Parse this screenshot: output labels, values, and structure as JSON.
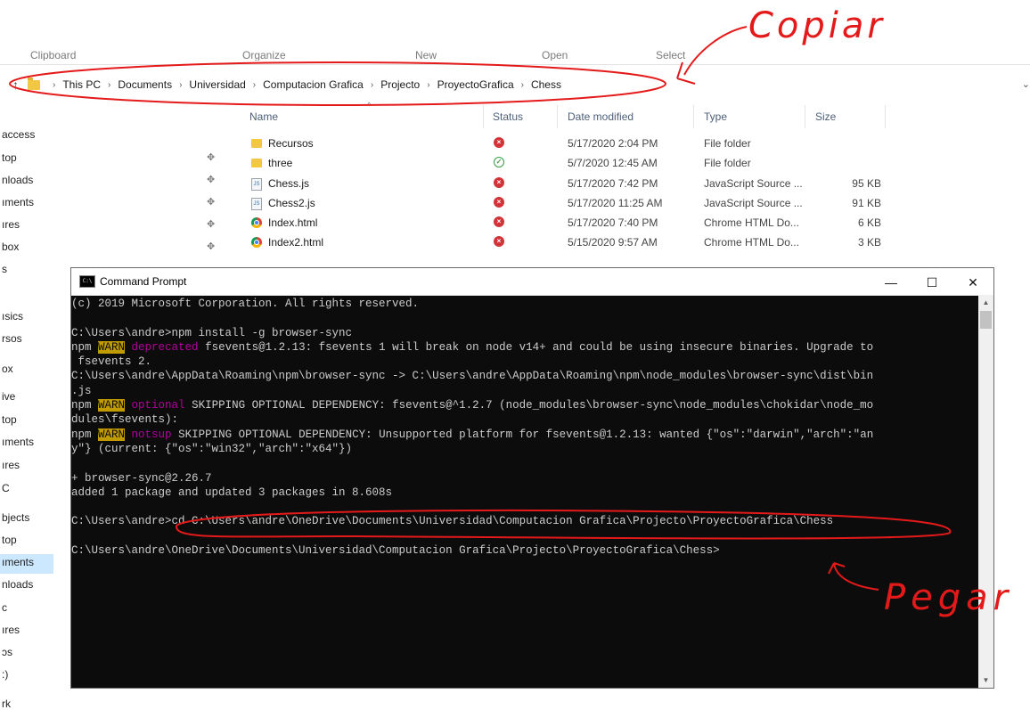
{
  "ribbon": {
    "groups": [
      "Clipboard",
      "Organize",
      "New",
      "Open",
      "Select"
    ]
  },
  "addressbar": {
    "up_icon": "arrow-up-icon",
    "crumbs": [
      "This PC",
      "Documents",
      "Universidad",
      "Computacion Grafica",
      "Projecto",
      "ProyectoGrafica",
      "Chess"
    ]
  },
  "sidebar": {
    "items": [
      "access",
      "top",
      "nloads",
      "ıments",
      "ıres",
      "box",
      "s",
      "ısics",
      "rsos",
      "ox",
      "ive",
      "top",
      "ıments",
      "ıres",
      "C",
      "bjects",
      "top",
      "ıments",
      "nloads",
      "c",
      "ıres",
      "ɔs",
      ":)",
      "rk"
    ],
    "selected_index": 17
  },
  "columns": {
    "name": "Name",
    "status": "Status",
    "date": "Date modified",
    "type": "Type",
    "size": "Size"
  },
  "files": [
    {
      "name": "Recursos",
      "icon": "folder-icon",
      "status": "error",
      "date": "5/17/2020 2:04 PM",
      "type": "File folder",
      "size": ""
    },
    {
      "name": "three",
      "icon": "folder-icon",
      "status": "ok",
      "date": "5/7/2020 12:45 AM",
      "type": "File folder",
      "size": ""
    },
    {
      "name": "Chess.js",
      "icon": "js-file-icon",
      "status": "error",
      "date": "5/17/2020 7:42 PM",
      "type": "JavaScript Source ...",
      "size": "95 KB"
    },
    {
      "name": "Chess2.js",
      "icon": "js-file-icon",
      "status": "error",
      "date": "5/17/2020 11:25 AM",
      "type": "JavaScript Source ...",
      "size": "91 KB"
    },
    {
      "name": "Index.html",
      "icon": "chrome-icon",
      "status": "error",
      "date": "5/17/2020 7:40 PM",
      "type": "Chrome HTML Do...",
      "size": "6 KB"
    },
    {
      "name": "Index2.html",
      "icon": "chrome-icon",
      "status": "error",
      "date": "5/15/2020 9:57 AM",
      "type": "Chrome HTML Do...",
      "size": "3 KB"
    }
  ],
  "cmd": {
    "title": "Command Prompt",
    "minimize": "—",
    "maximize": "☐",
    "close": "✕",
    "lines": [
      [
        {
          "t": "(c) 2019 Microsoft Corporation. All rights reserved."
        }
      ],
      [
        {
          "t": ""
        }
      ],
      [
        {
          "t": "C:\\Users\\andre>npm install -g browser-sync"
        }
      ],
      [
        {
          "t": "npm "
        },
        {
          "t": "WARN",
          "c": "warn"
        },
        {
          "t": " "
        },
        {
          "t": "deprecated",
          "c": "mag"
        },
        {
          "t": " fsevents@1.2.13: fsevents 1 will break on node v14+ and could be using insecure binaries. Upgrade to"
        }
      ],
      [
        {
          "t": " fsevents 2."
        }
      ],
      [
        {
          "t": "C:\\Users\\andre\\AppData\\Roaming\\npm\\browser-sync -> C:\\Users\\andre\\AppData\\Roaming\\npm\\node_modules\\browser-sync\\dist\\bin"
        }
      ],
      [
        {
          "t": ".js"
        }
      ],
      [
        {
          "t": "npm "
        },
        {
          "t": "WARN",
          "c": "warn"
        },
        {
          "t": " "
        },
        {
          "t": "optional",
          "c": "mag"
        },
        {
          "t": " SKIPPING OPTIONAL DEPENDENCY: fsevents@^1.2.7 (node_modules\\browser-sync\\node_modules\\chokidar\\node_mo"
        }
      ],
      [
        {
          "t": "dules\\fsevents):"
        }
      ],
      [
        {
          "t": "npm "
        },
        {
          "t": "WARN",
          "c": "warn"
        },
        {
          "t": " "
        },
        {
          "t": "notsup",
          "c": "mag"
        },
        {
          "t": " SKIPPING OPTIONAL DEPENDENCY: Unsupported platform for fsevents@1.2.13: wanted {\"os\":\"darwin\",\"arch\":\"an"
        }
      ],
      [
        {
          "t": "y\"} (current: {\"os\":\"win32\",\"arch\":\"x64\"})"
        }
      ],
      [
        {
          "t": ""
        }
      ],
      [
        {
          "t": "+ browser-sync@2.26.7"
        }
      ],
      [
        {
          "t": "added 1 package and updated 3 packages in 8.608s"
        }
      ],
      [
        {
          "t": ""
        }
      ],
      [
        {
          "t": "C:\\Users\\andre>cd C:\\Users\\andre\\OneDrive\\Documents\\Universidad\\Computacion Grafica\\Projecto\\ProyectoGrafica\\Chess"
        }
      ],
      [
        {
          "t": ""
        }
      ],
      [
        {
          "t": "C:\\Users\\andre\\OneDrive\\Documents\\Universidad\\Computacion Grafica\\Projecto\\ProyectoGrafica\\Chess>"
        }
      ]
    ]
  },
  "annotations": {
    "copy_label": "Copiar",
    "paste_label": "Pegar",
    "color": "#e41a1a"
  }
}
